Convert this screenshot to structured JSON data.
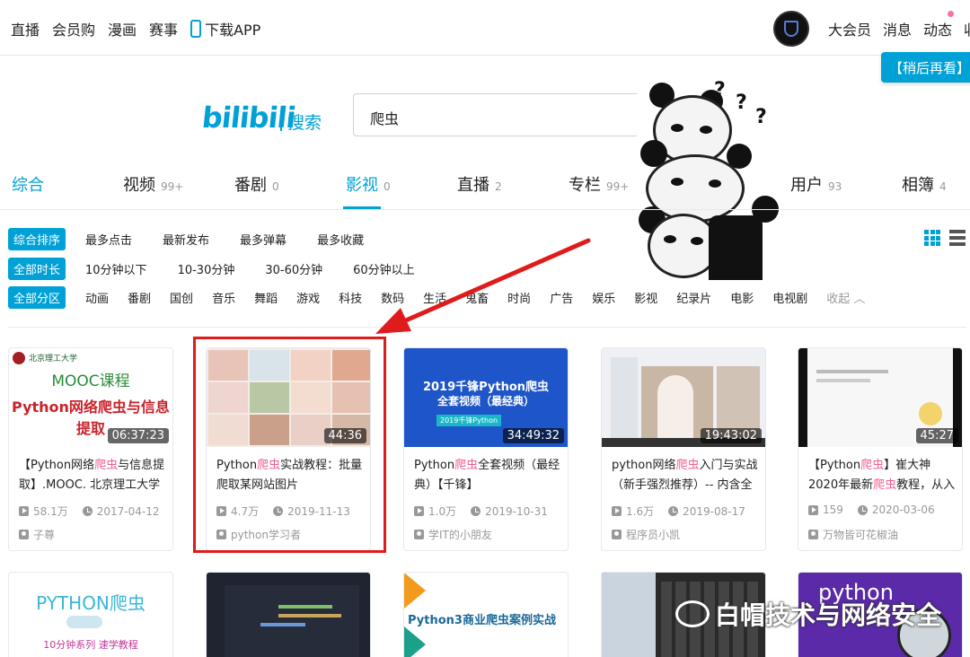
{
  "topnav": {
    "left_items": [
      "直播",
      "会员购",
      "漫画",
      "赛事"
    ],
    "download_app": "下载APP",
    "right_items": [
      "大会员",
      "消息",
      "动态",
      "收"
    ]
  },
  "watch_later": "【稍后再看】",
  "search": {
    "logo": "bilibili",
    "logo_suffix": "搜索",
    "query": "爬虫"
  },
  "tabs": [
    {
      "label": "综合",
      "count": ""
    },
    {
      "label": "视频",
      "count": "99+"
    },
    {
      "label": "番剧",
      "count": "0"
    },
    {
      "label": "影视",
      "count": "0"
    },
    {
      "label": "直播",
      "count": "2"
    },
    {
      "label": "专栏",
      "count": "99+"
    },
    {
      "label": "用户",
      "count": "93"
    },
    {
      "label": "相簿",
      "count": "4"
    }
  ],
  "filters": {
    "sort": {
      "selected": "综合排序",
      "options": [
        "最多点击",
        "最新发布",
        "最多弹幕",
        "最多收藏"
      ]
    },
    "duration": {
      "selected": "全部时长",
      "options": [
        "10分钟以下",
        "10-30分钟",
        "30-60分钟",
        "60分钟以上"
      ]
    },
    "region": {
      "selected": "全部分区",
      "options": [
        "动画",
        "番剧",
        "国创",
        "音乐",
        "舞蹈",
        "游戏",
        "科技",
        "数码",
        "生活",
        "鬼畜",
        "时尚",
        "广告",
        "娱乐",
        "影视",
        "纪录片",
        "电影",
        "电视剧"
      ],
      "collapse": "收起"
    }
  },
  "videos": [
    {
      "thumb_caption": "MOOC课程",
      "thumb_title": "Python网络爬虫与信息提取",
      "thumb_school": "北京理工大学",
      "duration": "06:37:23",
      "title_pre": "【Python网络",
      "title_hl": "爬虫",
      "title_post": "与信息提取】.MOOC. 北京理工大学",
      "views": "58.1万",
      "date": "2017-04-12",
      "uploader": "子尊"
    },
    {
      "duration": "44:36",
      "title_pre": "Python",
      "title_hl": "爬虫",
      "title_post": "实战教程：批量爬取某网站图片",
      "views": "4.7万",
      "date": "2019-11-13",
      "uploader": "python学习者"
    },
    {
      "thumb_title": "2019千锋Python爬虫",
      "thumb_sub": "全套视频（最经典）",
      "thumb_badge": "2019千锋Python",
      "duration": "34:49:32",
      "title_pre": "Python",
      "title_hl": "爬虫",
      "title_post": "全套视频（最经典）【千锋】",
      "views": "1.0万",
      "date": "2019-10-31",
      "uploader": "学IT的小朋友"
    },
    {
      "duration": "19:43:02",
      "title_pre": "python网络",
      "title_hl": "爬虫",
      "title_post": "入门与实战（新手强烈推荐）-- 内含全",
      "views": "1.6万",
      "date": "2019-08-17",
      "uploader": "程序员小凯"
    },
    {
      "duration": "45:27",
      "title_pre": "【Python",
      "title_hl": "爬虫",
      "title_post": "】崔大神2020年最新",
      "title_hl2": "爬虫",
      "title_post2": "教程，从入",
      "views": "159",
      "date": "2020-03-06",
      "uploader": "万物皆可花椒油"
    }
  ],
  "bottom_cards": [
    {
      "text": "PYTHON爬虫",
      "sub": "10分钟系列 速学教程"
    },
    {
      "text": ""
    },
    {
      "text": "Python3商业爬虫案例实战"
    },
    {
      "text": ""
    },
    {
      "text": "python"
    }
  ],
  "watermark": "白帽技术与网络安全",
  "colors": {
    "brand": "#00a1d6",
    "highlight": "#f25d8e",
    "annotation": "#e01b1b"
  }
}
